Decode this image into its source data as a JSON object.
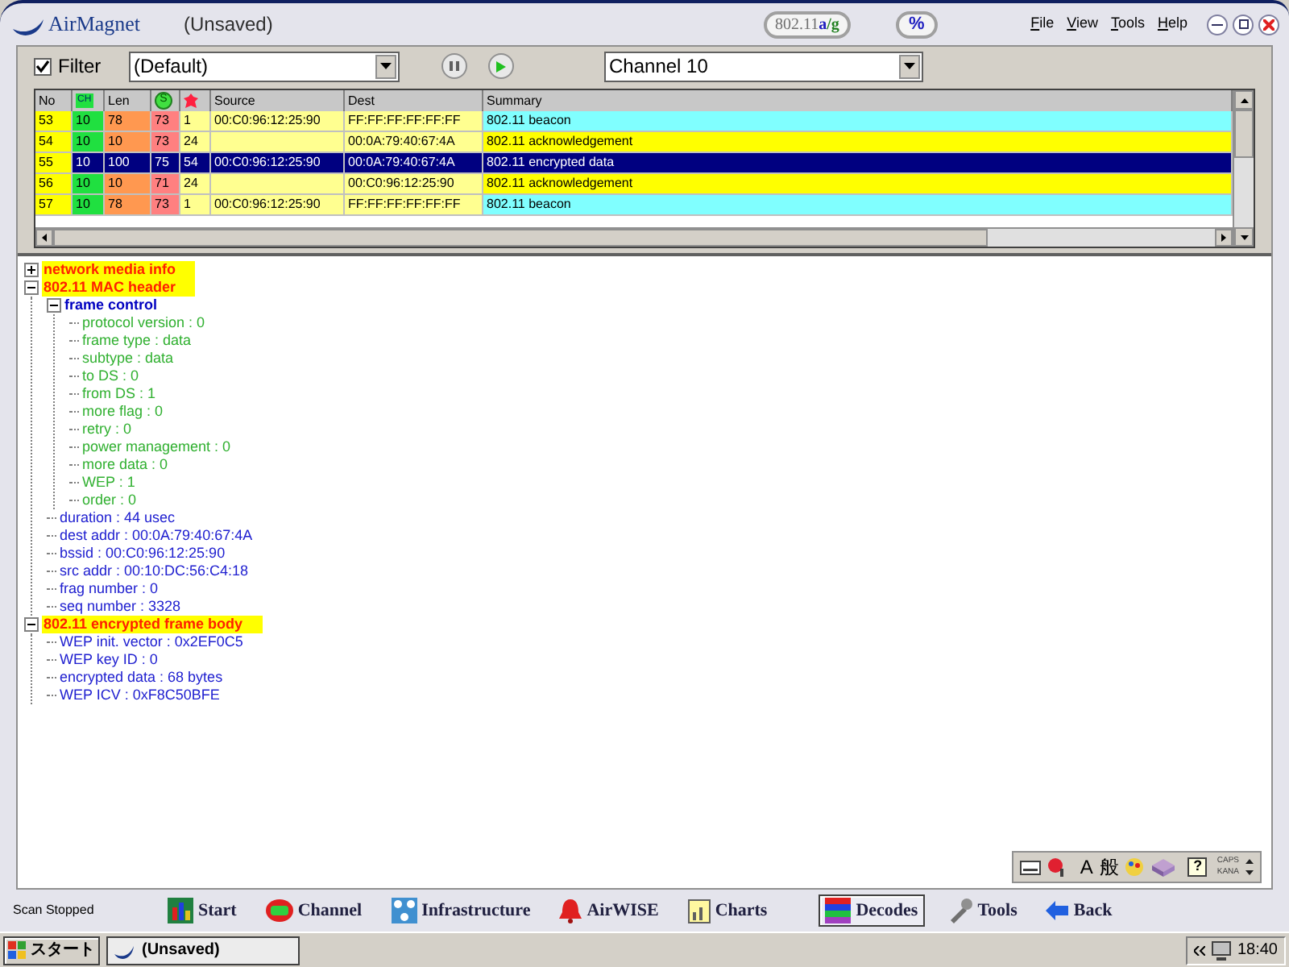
{
  "title_bar": {
    "logo": "AirMagnet",
    "document": "(Unsaved)",
    "band_badge": [
      {
        "text": "802.11",
        "color": "#707070"
      },
      {
        "text": "a",
        "color": "#2020c0"
      },
      {
        "text": "/g",
        "color": "#208020"
      }
    ],
    "percent_button": "%",
    "menu": [
      "File",
      "View",
      "Tools",
      "Help"
    ]
  },
  "toolbar": {
    "filter": {
      "label": "Filter",
      "checked": true
    },
    "profile": "(Default)",
    "channel": "Channel 10"
  },
  "table": {
    "columns": [
      {
        "kind": "text",
        "label": "No"
      },
      {
        "kind": "ch",
        "label": "CH"
      },
      {
        "kind": "text",
        "label": "Len"
      },
      {
        "kind": "signal",
        "label": "S"
      },
      {
        "kind": "blob"
      },
      {
        "kind": "text",
        "label": "Source"
      },
      {
        "kind": "text",
        "label": "Dest"
      },
      {
        "kind": "text",
        "label": "Summary"
      }
    ],
    "rows": [
      {
        "selected": false,
        "color": "#80ffff",
        "cells": [
          "53",
          "10",
          "78",
          "73",
          "1",
          "00:C0:96:12:25:90",
          "FF:FF:FF:FF:FF:FF",
          "802.11 beacon"
        ]
      },
      {
        "selected": false,
        "color": "#ffff00",
        "cells": [
          "54",
          "10",
          "10",
          "73",
          "24",
          "",
          "00:0A:79:40:67:4A",
          "802.11 acknowledgement"
        ]
      },
      {
        "selected": true,
        "cells": [
          "55",
          "10",
          "100",
          "75",
          "54",
          "00:C0:96:12:25:90",
          "00:0A:79:40:67:4A",
          "802.11 encrypted data"
        ]
      },
      {
        "selected": false,
        "color": "#ffff00",
        "cells": [
          "56",
          "10",
          "10",
          "71",
          "24",
          "",
          "00:C0:96:12:25:90",
          "802.11 acknowledgement"
        ]
      },
      {
        "selected": false,
        "color": "#80ffff",
        "cells": [
          "57",
          "10",
          "78",
          "73",
          "1",
          "00:C0:96:12:25:90",
          "FF:FF:FF:FF:FF:FF",
          "802.11 beacon"
        ]
      }
    ]
  },
  "tree": [
    {
      "kind": "section",
      "label": "network media info",
      "expanded": false
    },
    {
      "kind": "section",
      "label": "802.11 MAC header",
      "expanded": true,
      "children": [
        {
          "kind": "group",
          "label": "frame control",
          "expanded": true,
          "children": [
            {
              "kind": "field",
              "label": "protocol version : 0"
            },
            {
              "kind": "field",
              "label": "frame type : data"
            },
            {
              "kind": "field",
              "label": "subtype : data"
            },
            {
              "kind": "field",
              "label": "to DS : 0"
            },
            {
              "kind": "field",
              "label": "from DS : 1"
            },
            {
              "kind": "field",
              "label": "more flag : 0"
            },
            {
              "kind": "field",
              "label": "retry : 0"
            },
            {
              "kind": "field",
              "label": "power management : 0"
            },
            {
              "kind": "field",
              "label": "more data : 0"
            },
            {
              "kind": "field",
              "label": "WEP : 1"
            },
            {
              "kind": "field",
              "label": "order : 0"
            }
          ]
        },
        {
          "kind": "field",
          "label": "duration : 44 usec"
        },
        {
          "kind": "field",
          "label": "dest addr : 00:0A:79:40:67:4A"
        },
        {
          "kind": "field",
          "label": "bssid : 00:C0:96:12:25:90"
        },
        {
          "kind": "field",
          "label": "src  addr : 00:10:DC:56:C4:18"
        },
        {
          "kind": "field",
          "label": "frag number : 0"
        },
        {
          "kind": "field",
          "label": "seq number : 3328"
        }
      ]
    },
    {
      "kind": "section",
      "label": "802.11 encrypted frame body",
      "expanded": true,
      "children": [
        {
          "kind": "field",
          "label": "WEP init. vector : 0x2EF0C5"
        },
        {
          "kind": "field",
          "label": "WEP key ID : 0"
        },
        {
          "kind": "field",
          "label": "encrypted data : 68 bytes"
        },
        {
          "kind": "field",
          "label": "WEP ICV : 0xF8C50BFE"
        }
      ]
    }
  ],
  "ime_bar": {
    "letter": "A",
    "mode": "般",
    "caps": "CAPS",
    "kana": "KANA",
    "help": "?"
  },
  "status": "Scan Stopped",
  "nav": [
    {
      "kind": "start",
      "label": "Start",
      "selected": false
    },
    {
      "kind": "channel",
      "label": "Channel",
      "selected": false
    },
    {
      "kind": "infrastructure",
      "label": "Infrastructure",
      "selected": false
    },
    {
      "kind": "airwise",
      "label": "AirWISE",
      "selected": false
    },
    {
      "kind": "charts",
      "label": "Charts",
      "selected": false
    },
    {
      "kind": "decodes",
      "label": "Decodes",
      "selected": true
    },
    {
      "kind": "tools",
      "label": "Tools",
      "selected": false
    },
    {
      "kind": "back",
      "label": "Back",
      "selected": false
    }
  ],
  "taskbar": {
    "start": "スタート",
    "task": "(Unsaved)",
    "clock": "18:40"
  }
}
